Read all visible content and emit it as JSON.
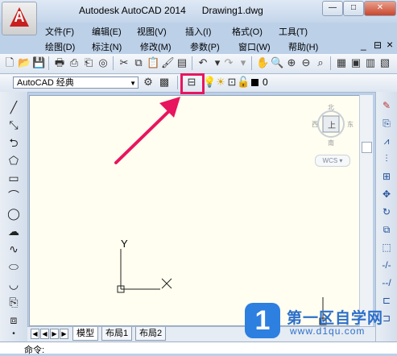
{
  "window": {
    "app_name": "Autodesk AutoCAD 2014",
    "document": "Drawing1.dwg",
    "buttons": {
      "minimize": "—",
      "restore": "□",
      "close": "✕"
    },
    "doc_buttons": {
      "minimize": "_",
      "restore": "⊟",
      "close": "×"
    }
  },
  "menubar": {
    "row1": [
      "文件(F)",
      "编辑(E)",
      "视图(V)",
      "插入(I)",
      "格式(O)",
      "工具(T)"
    ],
    "row2": [
      "绘图(D)",
      "标注(N)",
      "修改(M)",
      "参数(P)",
      "窗口(W)",
      "帮助(H)"
    ]
  },
  "toolbar": {
    "workspace": "AutoCAD 经典",
    "layer_value": "0"
  },
  "tabs": {
    "model": "模型",
    "layout1": "布局1",
    "layout2": "布局2"
  },
  "command": {
    "prompt": "命令:"
  },
  "viewcube": {
    "north": "北",
    "south": "南",
    "east": "东",
    "west": "西",
    "face": "上",
    "wcs": "WCS"
  },
  "ucs": {
    "y_label": "Y",
    "x_label": "X"
  },
  "watermark": {
    "title": "第一区自学网",
    "url": "www.d1qu.com"
  },
  "colors": {
    "highlight": "#e8155f",
    "canvas": "#fffef0"
  }
}
